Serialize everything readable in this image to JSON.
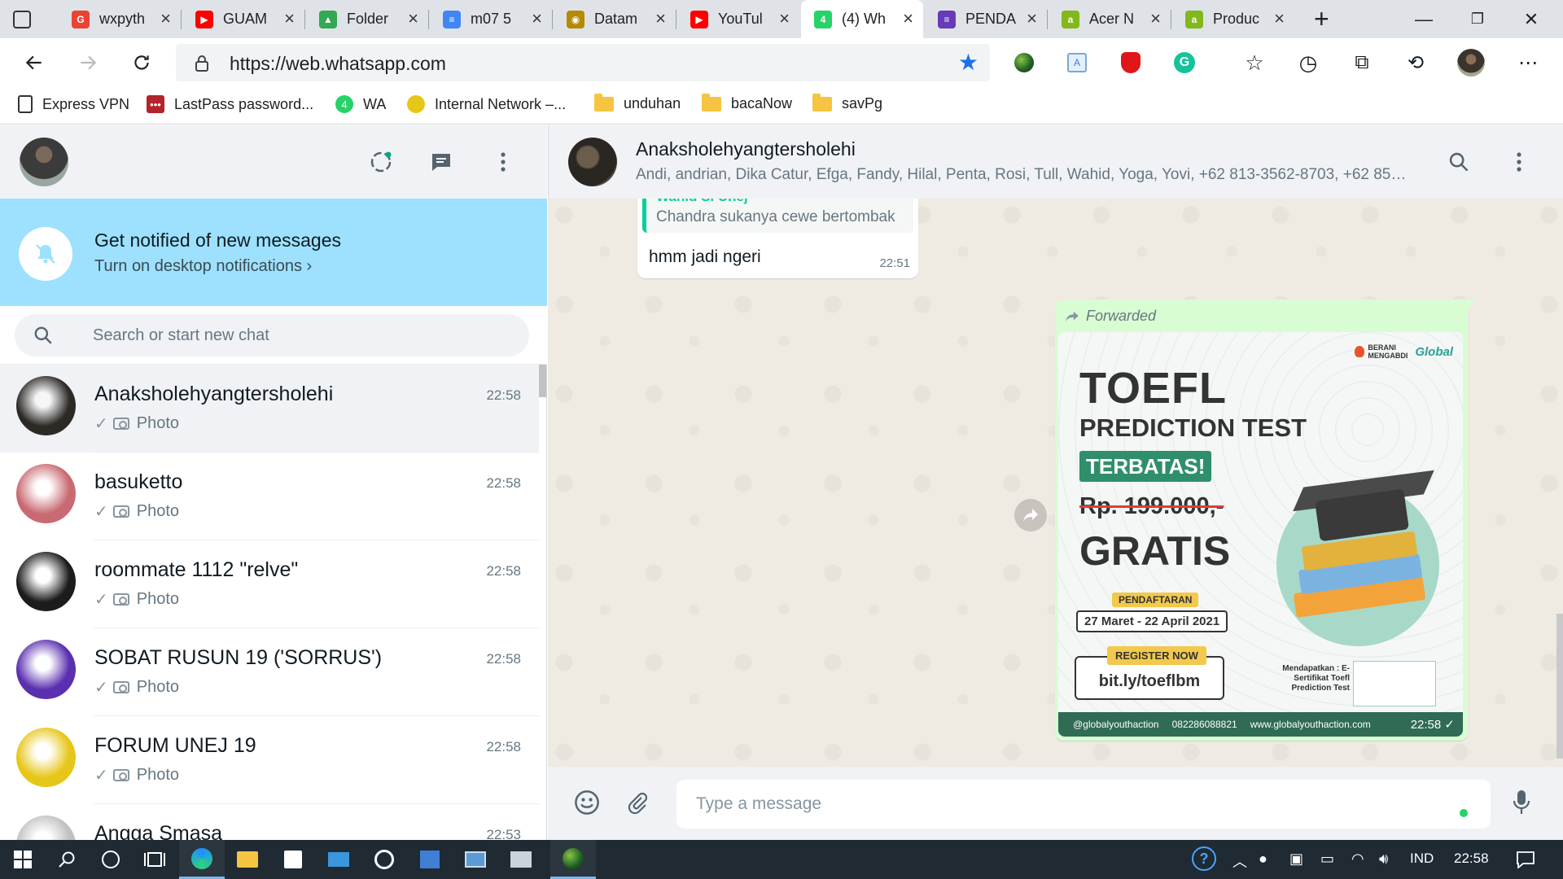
{
  "browser": {
    "tabs": [
      {
        "label": "wxpyth",
        "color": "#ea4335",
        "glyph": "G"
      },
      {
        "label": "GUAM",
        "color": "#ff0000",
        "glyph": "▶"
      },
      {
        "label": "Folder",
        "color": "#34a853",
        "glyph": "▲"
      },
      {
        "label": "m07 5",
        "color": "#4285f4",
        "glyph": "≡"
      },
      {
        "label": "Datam",
        "color": "#b58900",
        "glyph": "◉"
      },
      {
        "label": "YouTul",
        "color": "#ff0000",
        "glyph": "▶"
      },
      {
        "label": "(4) Wh",
        "color": "#25d366",
        "glyph": "4"
      },
      {
        "label": "PENDA",
        "color": "#673ab7",
        "glyph": "≡"
      },
      {
        "label": "Acer N",
        "color": "#83b81a",
        "glyph": "a"
      },
      {
        "label": "Produc",
        "color": "#83b81a",
        "glyph": "a"
      }
    ],
    "active_tab_index": 6,
    "url": "https://web.whatsapp.com",
    "bookmarks": [
      {
        "label": "Express VPN",
        "kind": "page"
      },
      {
        "label": "LastPass password...",
        "kind": "lastpass"
      },
      {
        "label": "WA",
        "kind": "wa"
      },
      {
        "label": "Internal Network –...",
        "kind": "unej"
      },
      {
        "label": "unduhan",
        "kind": "folder"
      },
      {
        "label": "bacaNow",
        "kind": "folder"
      },
      {
        "label": "savPg",
        "kind": "folder"
      }
    ]
  },
  "whatsapp": {
    "notification": {
      "title": "Get notified of new messages",
      "action": "Turn on desktop notifications ›"
    },
    "search": {
      "placeholder": "Search or start new chat"
    },
    "chats": [
      {
        "name": "Anaksholehyangtersholehi",
        "time": "22:58",
        "preview": "Photo",
        "avatar": "#2d2a26",
        "selected": true
      },
      {
        "name": "basuketto",
        "time": "22:58",
        "preview": "Photo",
        "avatar": "#c96a72",
        "selected": false
      },
      {
        "name": "roommate 1112 \"relve\"",
        "time": "22:58",
        "preview": "Photo",
        "avatar": "#1c1c1c",
        "selected": false
      },
      {
        "name": "SOBAT RUSUN 19 ('SORRUS')",
        "time": "22:58",
        "preview": "Photo",
        "avatar": "#5a2fb0",
        "selected": false
      },
      {
        "name": "FORUM UNEJ 19",
        "time": "22:58",
        "preview": "Photo",
        "avatar": "#e6c619",
        "selected": false
      },
      {
        "name": "Angga Smasa",
        "time": "22:53",
        "preview": "",
        "avatar": "#c0c0c0",
        "selected": false
      }
    ],
    "conversation": {
      "name": "Anaksholehyangtersholehi",
      "members": "Andi, andrian, Dika Catur, Efga, Fandy, Hilal, Penta, Rosi, Tull, Wahid, Yoga, Yovi, +62 813-3562-8703, +62 851...",
      "incoming": {
        "quote_author": "Wahid SI Unej",
        "quote_text": "Chandra sukanya cewe bertombak",
        "text": "hmm jadi ngeri",
        "time": "22:51"
      },
      "outgoing": {
        "forwarded_label": "Forwarded",
        "time": "22:58",
        "poster": {
          "brand_left": "BERANI MENGABDI",
          "brand_right": "Global",
          "title": "TOEFL",
          "subtitle": "PREDICTION TEST",
          "tag": "TERBATAS!",
          "old_price": "Rp. 199.000,-",
          "free": "GRATIS",
          "reg_label": "PENDAFTARAN",
          "dates": "27 Maret - 22 April 2021",
          "register": "REGISTER NOW",
          "link": "bit.ly/toeflbm",
          "cert_note": "Mendapatkan : E-Sertifikat Toefl Prediction Test",
          "ig": "@globalyouthaction",
          "wa": "082286088821",
          "web": "www.globalyouthaction.com"
        }
      },
      "composer_placeholder": "Type a message"
    }
  },
  "taskbar": {
    "language": "IND",
    "clock": "22:58"
  }
}
